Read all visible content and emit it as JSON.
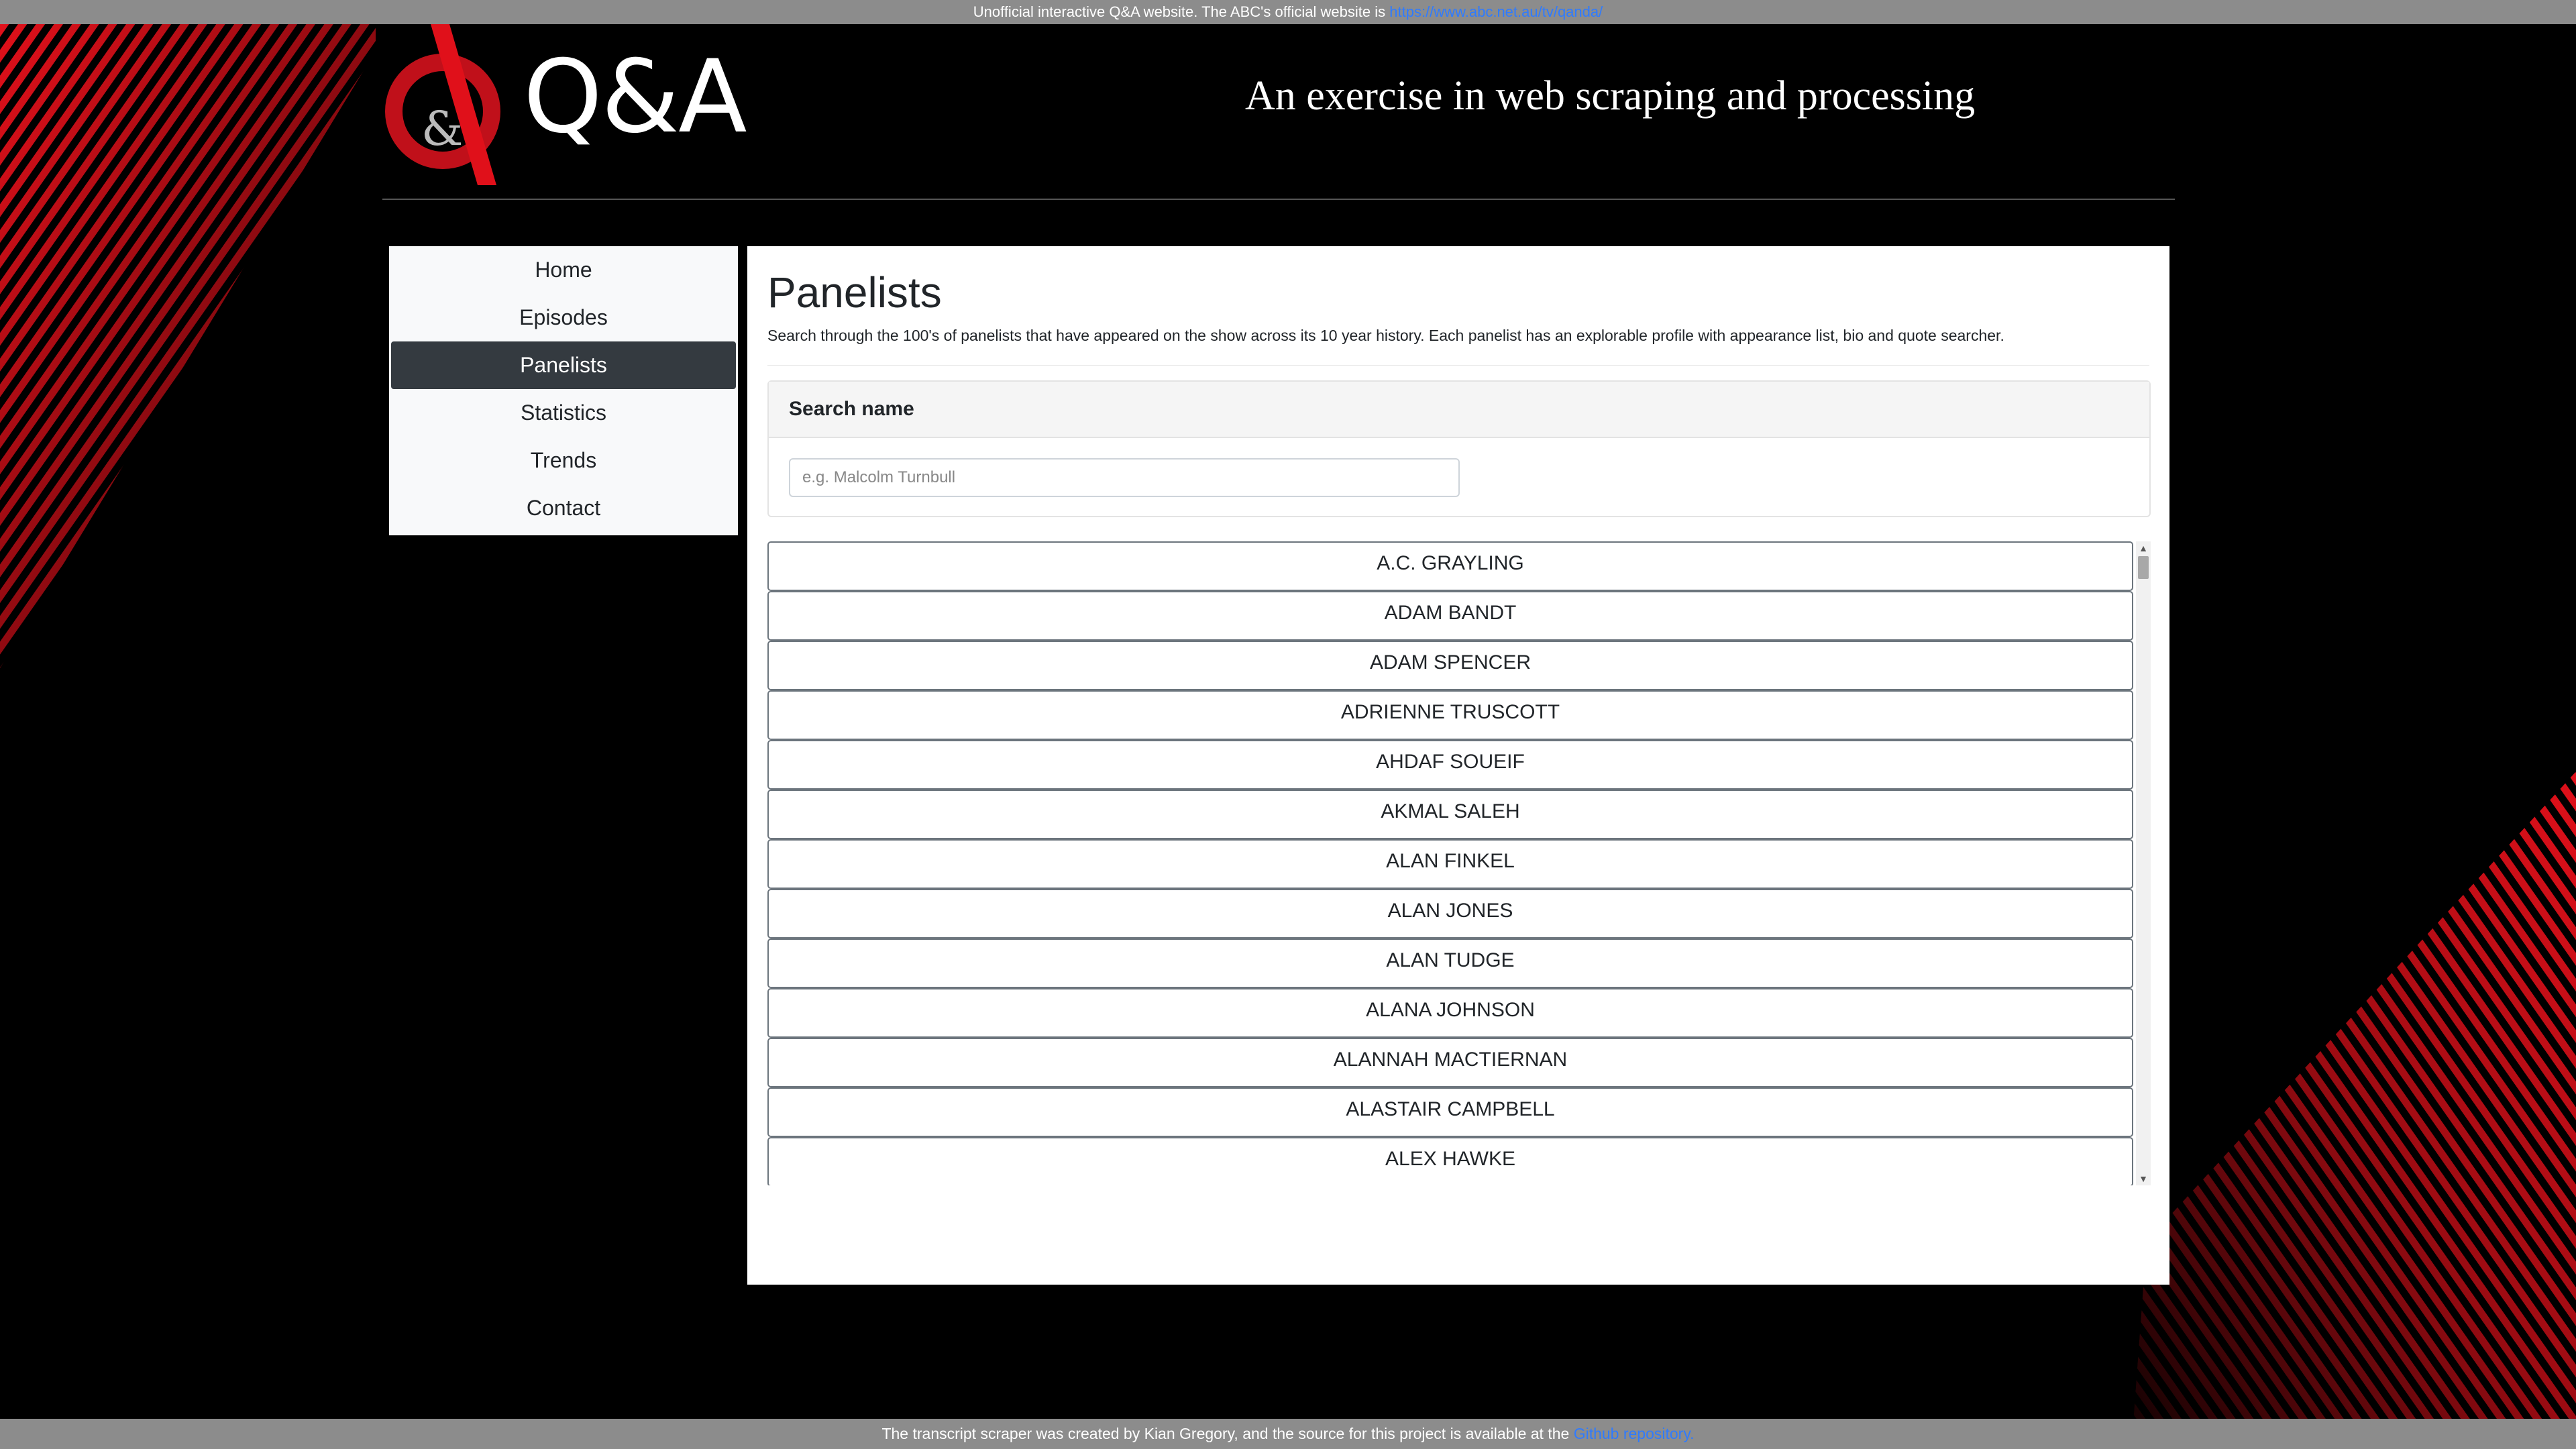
{
  "topbar": {
    "text": "Unofficial interactive Q&A website. The ABC's official website is",
    "link": "https://www.abc.net.au/tv/qanda/"
  },
  "header": {
    "logo_text": "Q&A",
    "logo_mark": "&",
    "tagline": "An exercise in web scraping and processing"
  },
  "nav": {
    "items": [
      {
        "label": "Home"
      },
      {
        "label": "Episodes"
      },
      {
        "label": "Panelists"
      },
      {
        "label": "Statistics"
      },
      {
        "label": "Trends"
      },
      {
        "label": "Contact"
      }
    ],
    "active_index": 2
  },
  "main": {
    "title": "Panelists",
    "description": "Search through the 100's of panelists that have appeared on the show across its 10 year history. Each panelist has an explorable profile with appearance list, bio and quote searcher.",
    "search": {
      "header": "Search name",
      "placeholder": "e.g. Malcolm Turnbull",
      "value": ""
    },
    "panelists": [
      "A.C. GRAYLING",
      "ADAM BANDT",
      "ADAM SPENCER",
      "ADRIENNE TRUSCOTT",
      "AHDAF SOUEIF",
      "AKMAL SALEH",
      "ALAN FINKEL",
      "ALAN JONES",
      "ALAN TUDGE",
      "ALANA JOHNSON",
      "ALANNAH MACTIERNAN",
      "ALASTAIR CAMPBELL",
      "ALEX HAWKE"
    ]
  },
  "footer": {
    "text": "The transcript scraper was created by Kian Gregory, and the source for this project is available at the",
    "link": "Github repository."
  },
  "colors": {
    "accent_red": "#e0101a",
    "active_nav": "#343a40",
    "link": "#2f7bff",
    "bar_grey": "#8c8c8c"
  }
}
